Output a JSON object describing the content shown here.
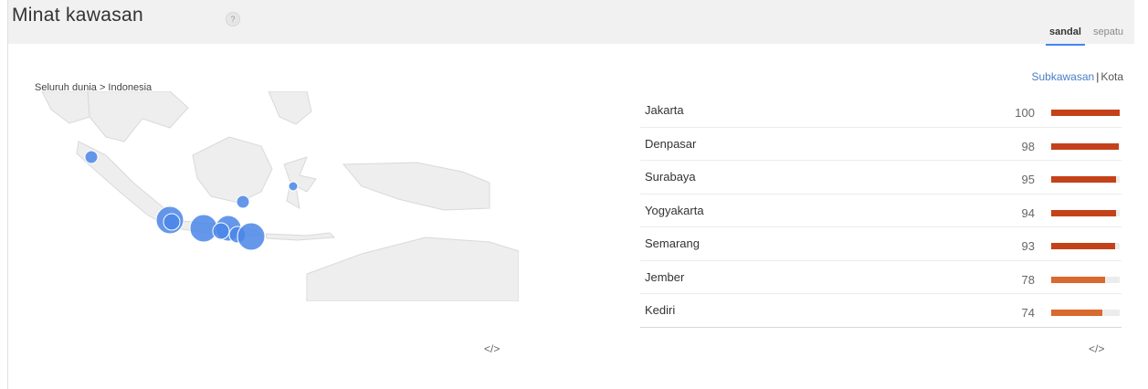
{
  "header": {
    "title": "Minat kawasan",
    "help_icon": "help-icon",
    "help_glyph": "?",
    "tabs": [
      {
        "label": "sandal",
        "active": true
      },
      {
        "label": "sepatu",
        "active": false
      }
    ]
  },
  "map": {
    "breadcrumb": "Seluruh dunia > Indonesia",
    "embed_label": "</>",
    "marker_color": "#4a86e8"
  },
  "regions": {
    "resolution_active": "Subkawasan",
    "resolution_sep": "|",
    "resolution_other": "Kota",
    "embed_label": "</>",
    "items": [
      {
        "name": "Jakarta",
        "value": 100
      },
      {
        "name": "Denpasar",
        "value": 98
      },
      {
        "name": "Surabaya",
        "value": 95
      },
      {
        "name": "Yogyakarta",
        "value": 94
      },
      {
        "name": "Semarang",
        "value": 93
      },
      {
        "name": "Jember",
        "value": 78
      },
      {
        "name": "Kediri",
        "value": 74
      }
    ]
  },
  "colors": {
    "bar_strong": "#c4421a",
    "bar_medium": "#d9692f",
    "accent": "#4285f4"
  }
}
